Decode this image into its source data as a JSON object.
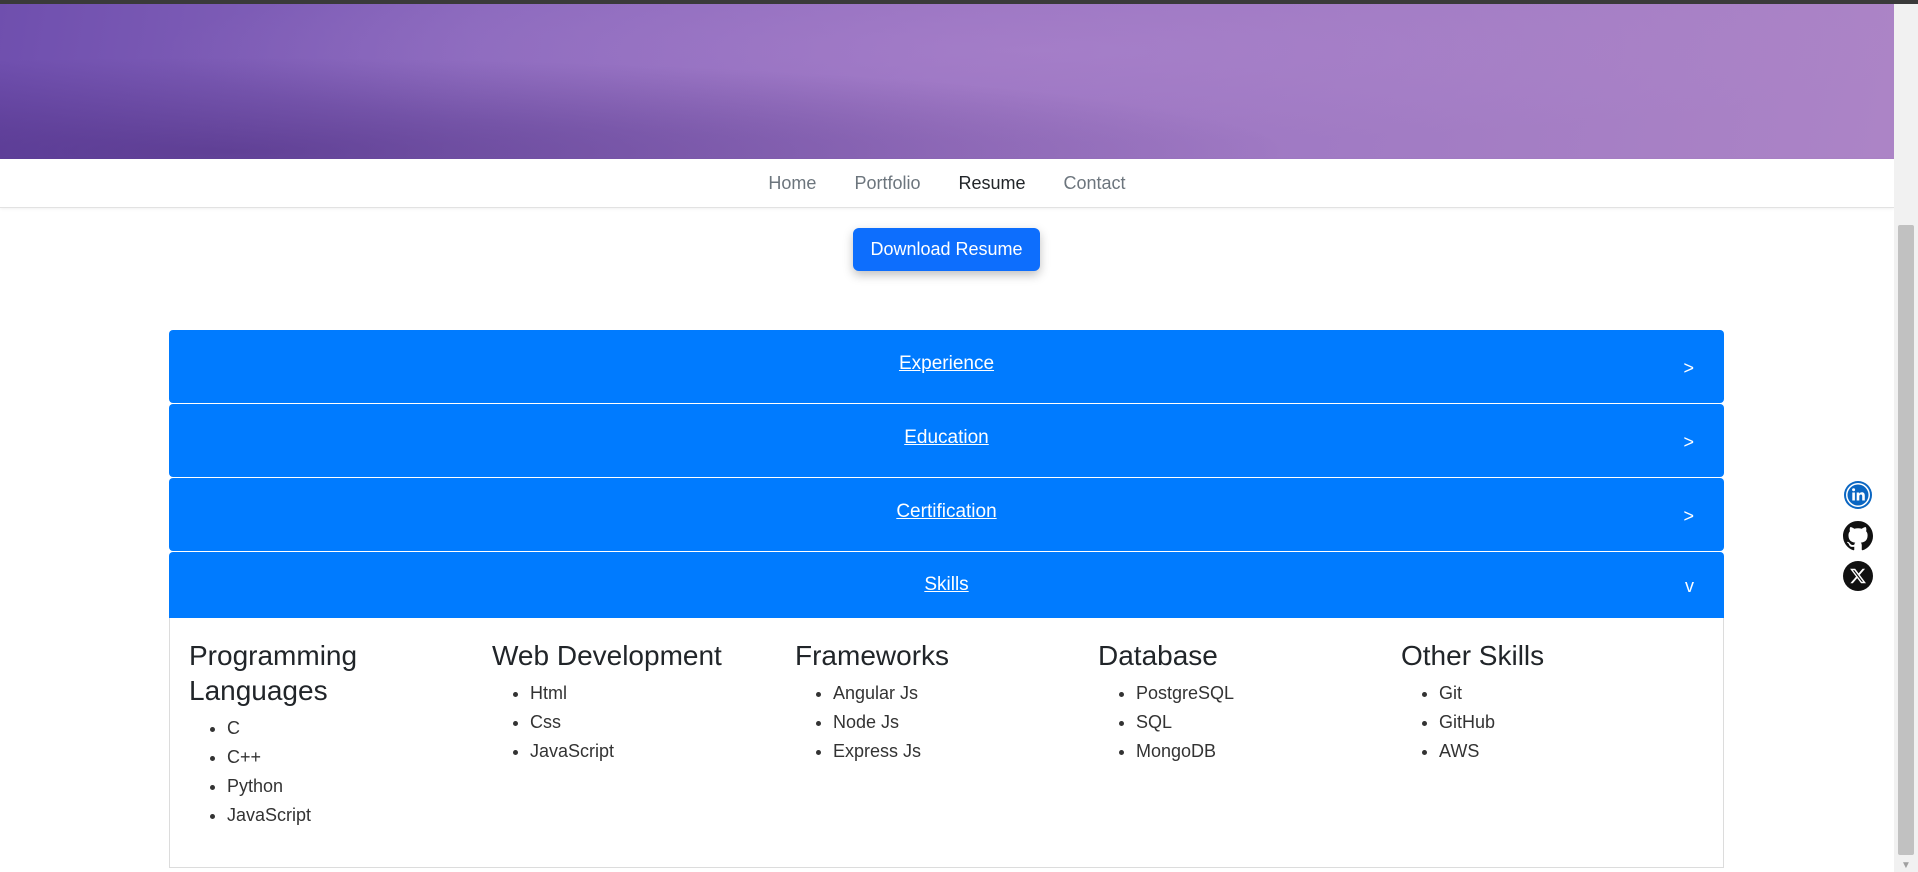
{
  "nav": {
    "items": [
      {
        "label": "Home",
        "active": false
      },
      {
        "label": "Portfolio",
        "active": false
      },
      {
        "label": "Resume",
        "active": true
      },
      {
        "label": "Contact",
        "active": false
      }
    ]
  },
  "download_button": "Download Resume",
  "accordion": {
    "sections": [
      {
        "title": "Experience",
        "indicator": ">",
        "expanded": false
      },
      {
        "title": "Education",
        "indicator": ">",
        "expanded": false
      },
      {
        "title": "Certification",
        "indicator": ">",
        "expanded": false
      },
      {
        "title": "Skills",
        "indicator": "v",
        "expanded": true
      }
    ]
  },
  "skills": [
    {
      "heading": "Programming Languages",
      "items": [
        "C",
        "C++",
        "Python",
        "JavaScript"
      ]
    },
    {
      "heading": "Web Development",
      "items": [
        "Html",
        "Css",
        "JavaScript"
      ]
    },
    {
      "heading": "Frameworks",
      "items": [
        "Angular Js",
        "Node Js",
        "Express Js"
      ]
    },
    {
      "heading": "Database",
      "items": [
        "PostgreSQL",
        "SQL",
        "MongoDB"
      ]
    },
    {
      "heading": "Other Skills",
      "items": [
        "Git",
        "GitHub",
        "AWS"
      ]
    }
  ],
  "social_icons": [
    "linkedin-icon",
    "github-icon",
    "x-icon"
  ],
  "colors": {
    "accordion_header": "#007bff",
    "primary_button": "#0d6efd",
    "hero_purple": "#9a74c2",
    "linkedin": "#0a66c2"
  }
}
